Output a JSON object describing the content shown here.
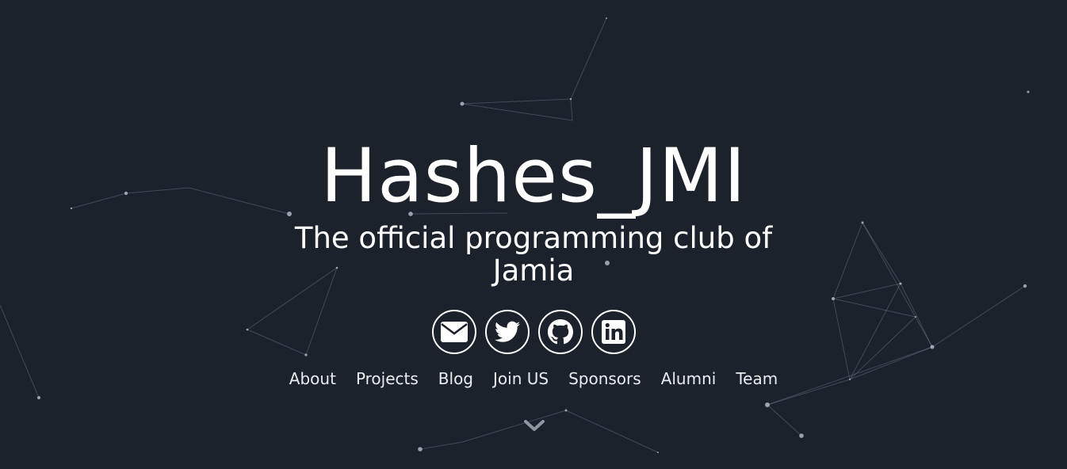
{
  "hero": {
    "title": "Hashes_JMI",
    "subtitle_line1": "The official programming club of",
    "subtitle_line2": "Jamia"
  },
  "socials": [
    {
      "icon": "envelope-icon"
    },
    {
      "icon": "twitter-icon"
    },
    {
      "icon": "github-icon"
    },
    {
      "icon": "linkedin-icon"
    }
  ],
  "nav": {
    "items": [
      "About",
      "Projects",
      "Blog",
      "Join US",
      "Sponsors",
      "Alumni",
      "Team"
    ]
  },
  "colors": {
    "background": "#1c222c",
    "text": "#ffffff",
    "particle": "#b9c0cc"
  },
  "scroll": {
    "icon": "chevron-down-icon"
  }
}
